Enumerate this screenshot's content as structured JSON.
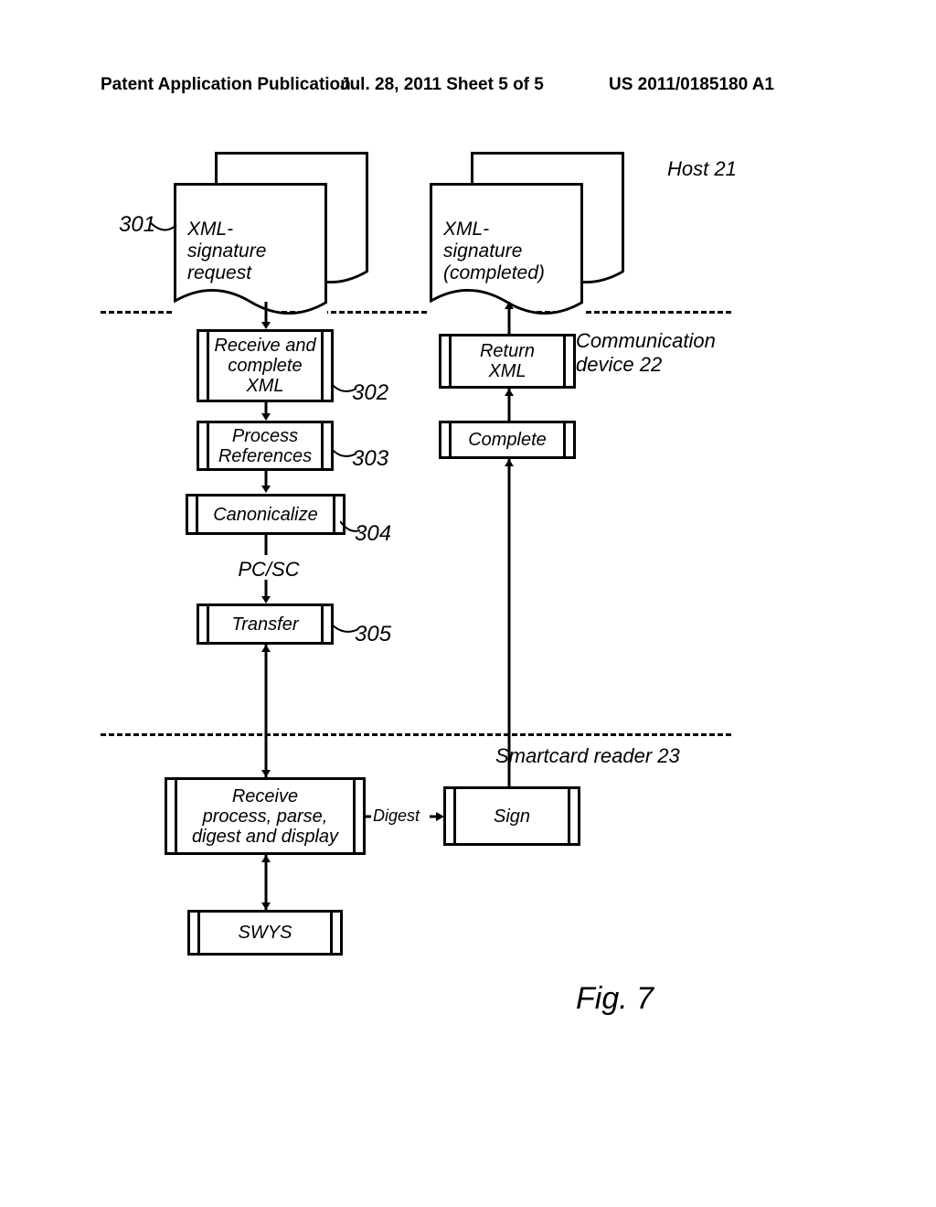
{
  "header": {
    "left": "Patent Application Publication",
    "mid": "Jul. 28, 2011  Sheet 5 of 5",
    "right": "US 2011/0185180 A1"
  },
  "layers": {
    "host": "Host 21",
    "comm": "Communication\ndevice 22",
    "reader": "Smartcard reader 23"
  },
  "docs": {
    "request": "XML-\nsignature\nrequest",
    "completed": "XML-\nsignature\n(completed)"
  },
  "steps": {
    "receive_complete_xml": "Receive and\ncomplete\nXML",
    "process_refs": "Process\nReferences",
    "canonicalize": "Canonicalize",
    "transfer": "Transfer",
    "receive_process": "Receive\nprocess, parse,\ndigest and display",
    "swys": "SWYS",
    "sign": "Sign",
    "complete": "Complete",
    "return_xml": "Return\nXML"
  },
  "mid_labels": {
    "pcsc": "PC/SC",
    "digest": "Digest"
  },
  "refs": {
    "r301": "301",
    "r302": "302",
    "r303": "303",
    "r304": "304",
    "r305": "305"
  },
  "figure": "Fig. 7"
}
